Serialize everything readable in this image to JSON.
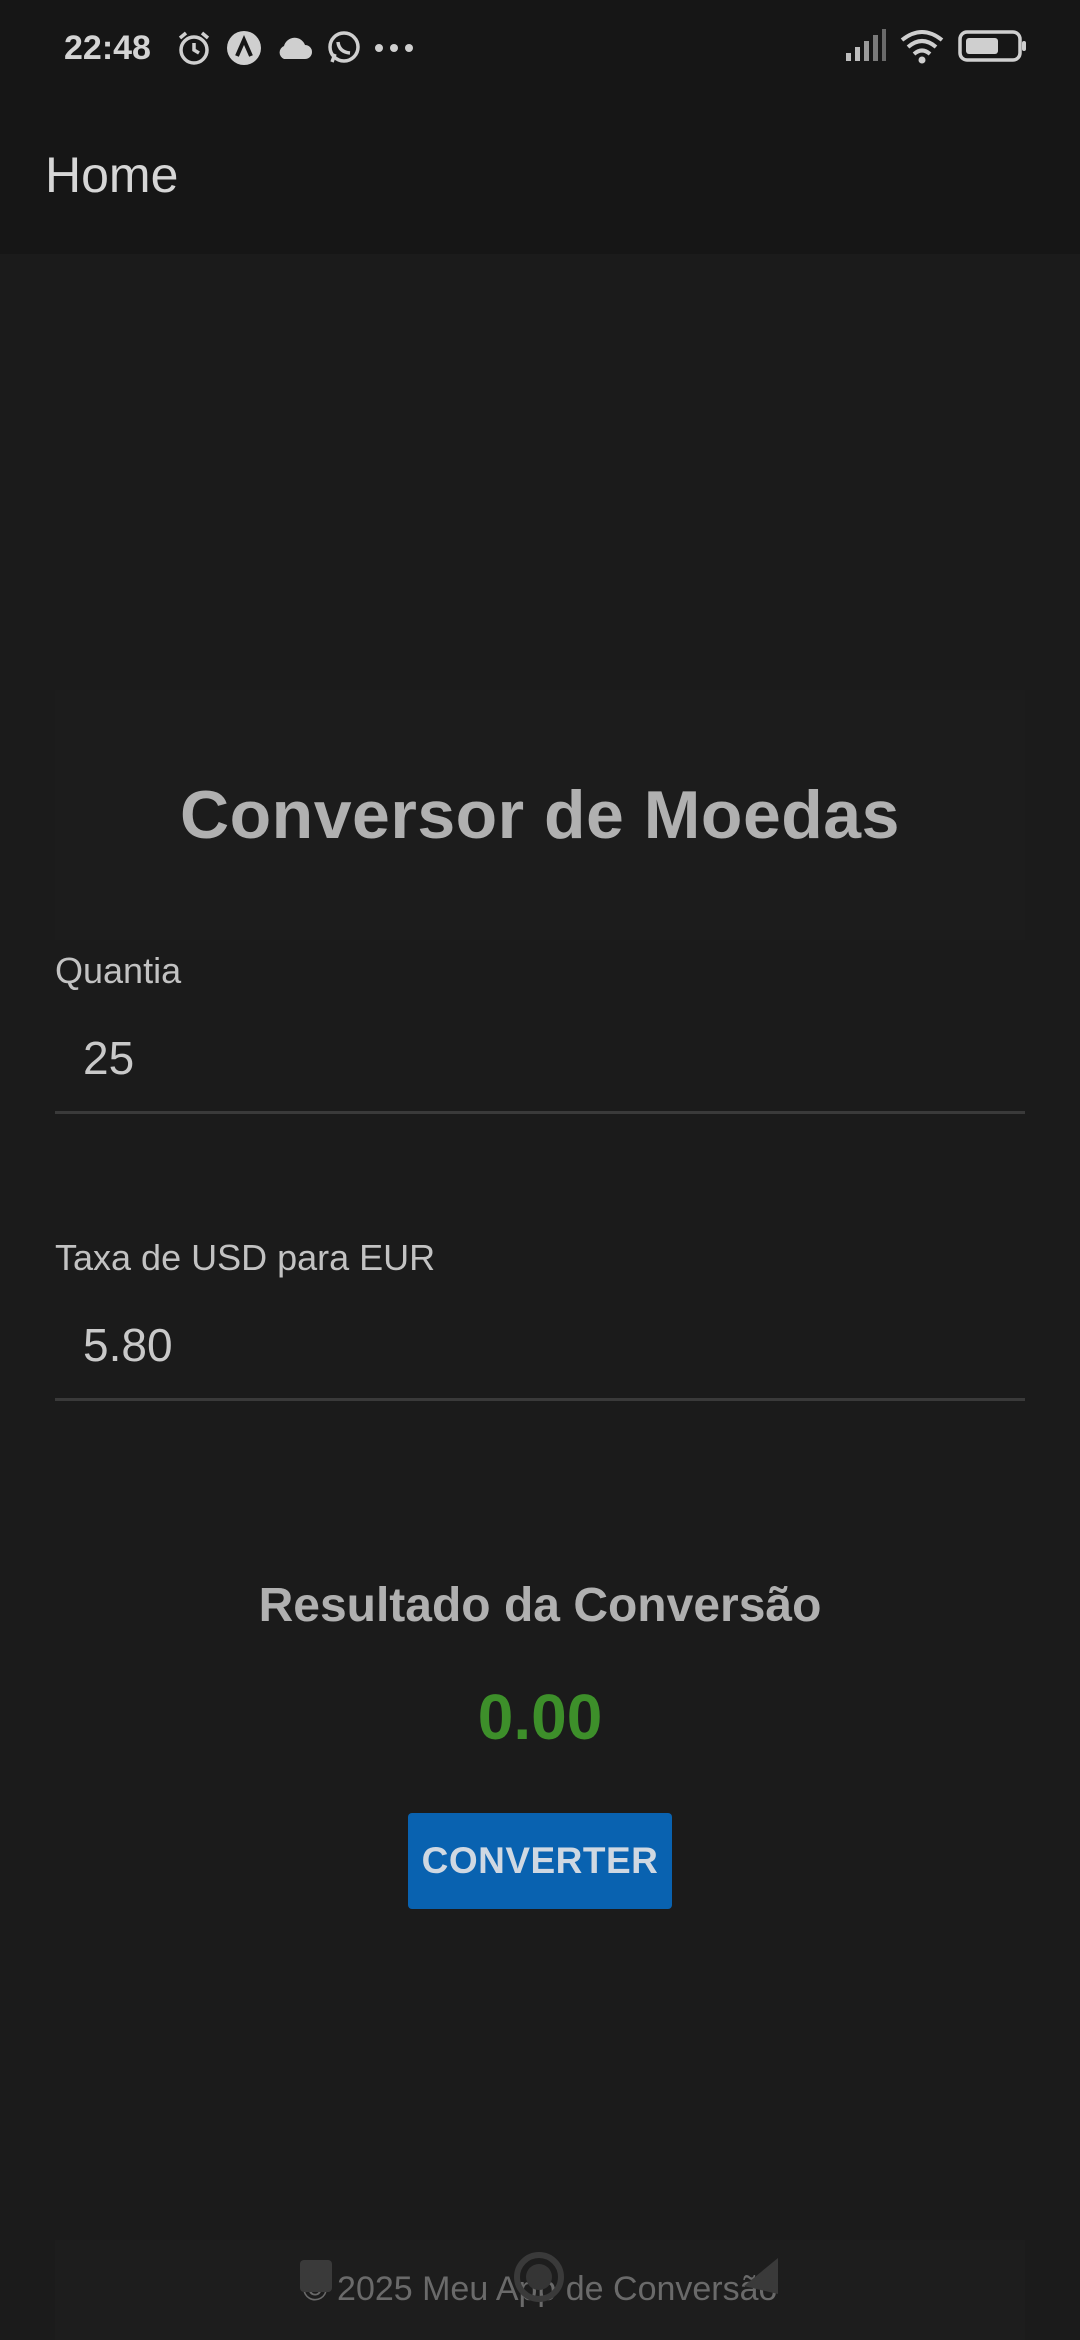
{
  "status_bar": {
    "time": "22:48",
    "left_icons": [
      "alarm-icon",
      "app-badge-icon",
      "cloud-icon",
      "whatsapp-icon",
      "more-dots-icon"
    ],
    "right_icons": [
      "signal-icon",
      "wifi-icon",
      "battery-icon"
    ]
  },
  "app_bar": {
    "title": "Home"
  },
  "converter": {
    "title": "Conversor de Moedas",
    "amount_label": "Quantia",
    "amount_value": "25",
    "rate_label": "Taxa de USD para EUR",
    "rate_value": "5.80",
    "result_title": "Resultado da Conversão",
    "result_value": "0.00",
    "convert_button": "CONVERTER"
  },
  "footer": {
    "text": "© 2025 Meu App de Conversão"
  },
  "nav_bar": {
    "buttons": [
      "recents-square-icon",
      "home-circle-icon",
      "back-triangle-icon"
    ]
  },
  "colors": {
    "background": "#1b1b1b",
    "result_green": "#3d8f2a",
    "button_blue": "#0962b0"
  }
}
